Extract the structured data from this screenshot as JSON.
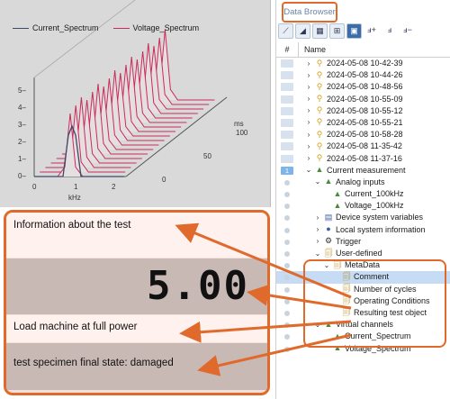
{
  "chart": {
    "legend": [
      {
        "name": "Current_Spectrum",
        "color": "#3e4a66"
      },
      {
        "name": "Voltage_Spectrum",
        "color": "#cc2a5a"
      }
    ],
    "y_ticks": [
      "5–",
      "4–",
      "3–",
      "2–",
      "1–",
      "0–"
    ],
    "x_ticks": [
      "0",
      "1",
      "2"
    ],
    "x_unit": "kHz",
    "z_unit": "ms",
    "z_ticks": [
      "100",
      "50",
      "0"
    ]
  },
  "info": {
    "row1": "Information about the test",
    "value": "5.00",
    "row3": "Load machine at full power",
    "row4": "test specimen final state: damaged"
  },
  "browser": {
    "title": "Data Browser",
    "col_num": "#",
    "col_name": "Name",
    "toolbar_icons": [
      "chart-line-icon",
      "chart-area-icon",
      "table-icon",
      "grid-icon",
      "monitor-icon",
      "curve-add-icon",
      "curve-icon",
      "curve-remove-icon"
    ],
    "rows": [
      {
        "label": "2024-05-08 10-42-39",
        "level": 0,
        "chev": "›",
        "icon": "rec",
        "marker": "bar"
      },
      {
        "label": "2024-05-08 10-44-26",
        "level": 0,
        "chev": "›",
        "icon": "rec",
        "marker": "bar"
      },
      {
        "label": "2024-05-08 10-48-56",
        "level": 0,
        "chev": "›",
        "icon": "rec",
        "marker": "bar"
      },
      {
        "label": "2024-05-08 10-55-09",
        "level": 0,
        "chev": "›",
        "icon": "rec",
        "marker": "bar"
      },
      {
        "label": "2024-05-08 10-55-12",
        "level": 0,
        "chev": "›",
        "icon": "rec",
        "marker": "bar"
      },
      {
        "label": "2024-05-08 10-55-21",
        "level": 0,
        "chev": "›",
        "icon": "rec",
        "marker": "bar"
      },
      {
        "label": "2024-05-08 10-58-28",
        "level": 0,
        "chev": "›",
        "icon": "rec",
        "marker": "bar"
      },
      {
        "label": "2024-05-08 11-35-42",
        "level": 0,
        "chev": "›",
        "icon": "rec",
        "marker": "bar"
      },
      {
        "label": "2024-05-08 11-37-16",
        "level": 0,
        "chev": "›",
        "icon": "rec",
        "marker": "bar"
      },
      {
        "label": "Current measurement",
        "level": 0,
        "chev": "⌄",
        "icon": "tri",
        "marker": "current",
        "marker_text": "1"
      },
      {
        "label": "Analog inputs",
        "level": 1,
        "chev": "⌄",
        "icon": "tri",
        "marker": "dot"
      },
      {
        "label": "Current_100kHz",
        "level": 2,
        "chev": "",
        "icon": "tri",
        "marker": "dot"
      },
      {
        "label": "Voltage_100kHz",
        "level": 2,
        "chev": "",
        "icon": "tri",
        "marker": "dot"
      },
      {
        "label": "Device system variables",
        "level": 1,
        "chev": "›",
        "icon": "chip",
        "marker": "dot"
      },
      {
        "label": "Local system information",
        "level": 1,
        "chev": "›",
        "icon": "globe",
        "marker": "dot"
      },
      {
        "label": "Trigger",
        "level": 1,
        "chev": "›",
        "icon": "gear",
        "marker": "dot"
      },
      {
        "label": "User-defined",
        "level": 1,
        "chev": "⌄",
        "icon": "doc",
        "marker": "dot"
      },
      {
        "label": "MetaData",
        "level": 2,
        "chev": "⌄",
        "icon": "doc",
        "marker": "dot"
      },
      {
        "label": "Comment",
        "level": 3,
        "chev": "",
        "icon": "doc",
        "marker": "dot",
        "selected": true
      },
      {
        "label": "Number of cycles",
        "level": 3,
        "chev": "",
        "icon": "doc",
        "marker": "dot"
      },
      {
        "label": "Operating Conditions",
        "level": 3,
        "chev": "",
        "icon": "doc",
        "marker": "dot"
      },
      {
        "label": "Resulting test object",
        "level": 3,
        "chev": "",
        "icon": "doc",
        "marker": "dot"
      },
      {
        "label": "Virtual channels",
        "level": 1,
        "chev": "⌄",
        "icon": "tri",
        "marker": "dot"
      },
      {
        "label": "Current_Spectrum",
        "level": 2,
        "chev": "",
        "icon": "curr",
        "marker": "dot"
      },
      {
        "label": "Voltage_Spectrum",
        "level": 2,
        "chev": "",
        "icon": "curr",
        "marker": "dot"
      }
    ]
  }
}
